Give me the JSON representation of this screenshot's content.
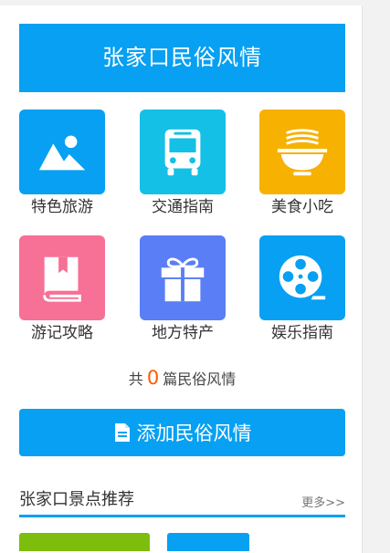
{
  "banner": {
    "title": "张家口民俗风情"
  },
  "categories": [
    {
      "label": "特色旅游",
      "icon": "landscape-icon",
      "color": "#07a0f2"
    },
    {
      "label": "交通指南",
      "icon": "bus-icon",
      "color": "#14c0e6"
    },
    {
      "label": "美食小吃",
      "icon": "noodle-bowl-icon",
      "color": "#f7b100"
    },
    {
      "label": "游记攻略",
      "icon": "book-icon",
      "color": "#f77096"
    },
    {
      "label": "地方特产",
      "icon": "gift-icon",
      "color": "#5a7ef5"
    },
    {
      "label": "娱乐指南",
      "icon": "film-reel-icon",
      "color": "#07a0f2"
    }
  ],
  "summary": {
    "prefix": "共",
    "count": "0",
    "suffix": "篇民俗风情",
    "count_color": "#ff5a00"
  },
  "add_button": {
    "label": "添加民俗风情",
    "icon": "document-icon"
  },
  "section": {
    "title": "张家口景点推荐",
    "more": "更多>>"
  },
  "recommend_cards": [
    {
      "color": "#7dbd0d"
    },
    {
      "color": "#07a0f2"
    }
  ],
  "theme": {
    "accent": "#07a0f2"
  }
}
